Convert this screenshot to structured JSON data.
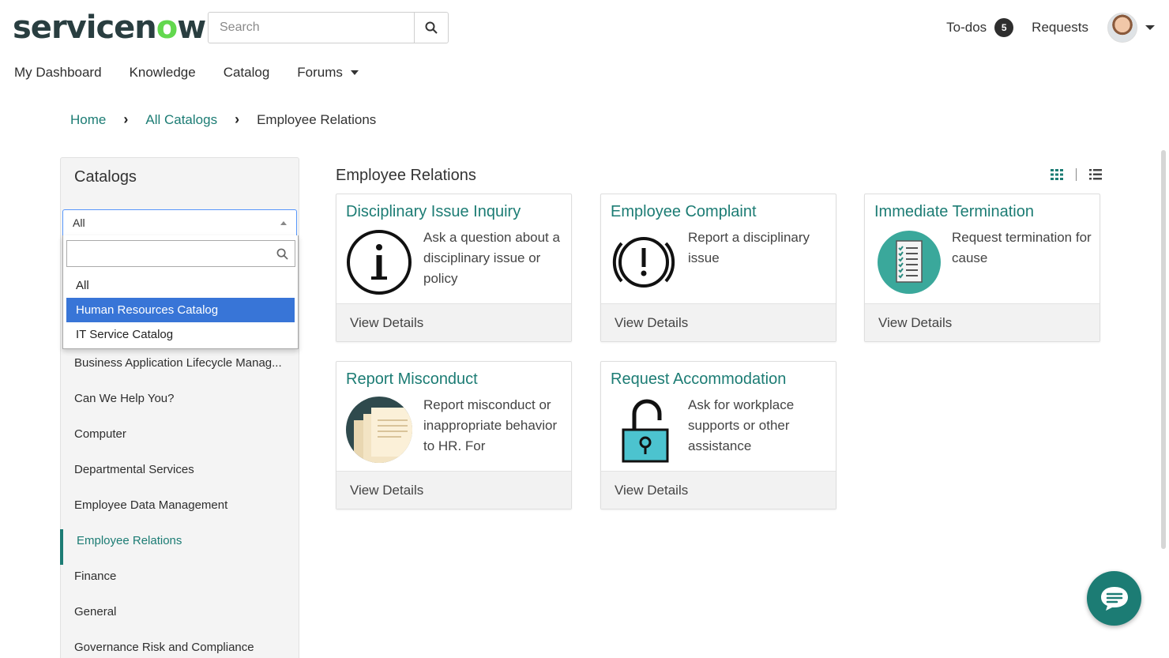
{
  "brand": {
    "logo_text_a": "servicen",
    "logo_text_o": "o",
    "logo_text_b": "w"
  },
  "search": {
    "placeholder": "Search"
  },
  "header": {
    "todos_label": "To-dos",
    "todos_count": "5",
    "requests_label": "Requests"
  },
  "nav": {
    "items": [
      "My Dashboard",
      "Knowledge",
      "Catalog",
      "Forums"
    ]
  },
  "breadcrumb": {
    "home": "Home",
    "all_catalogs": "All Catalogs",
    "current": "Employee Relations"
  },
  "sidebar": {
    "title": "Catalogs",
    "select_value": "All",
    "dropdown_options": [
      "All",
      "Human Resources Catalog",
      "IT Service Catalog"
    ],
    "categories": [
      "Business Application Lifecycle Manag...",
      "Can We Help You?",
      "Computer",
      "Departmental Services",
      "Employee Data Management",
      "Employee Relations",
      "Finance",
      "General",
      "Governance Risk and Compliance"
    ]
  },
  "main": {
    "title": "Employee Relations",
    "cards": [
      {
        "title": "Disciplinary Issue Inquiry",
        "desc": "Ask a question about a disciplinary issue or policy",
        "footer": "View Details",
        "icon": "info-icon"
      },
      {
        "title": "Employee Complaint",
        "desc": "Report a disciplinary issue",
        "footer": "View Details",
        "icon": "alert-icon"
      },
      {
        "title": "Immediate Termination",
        "desc": "Request termination for cause",
        "footer": "View Details",
        "icon": "checklist-icon"
      },
      {
        "title": "Report Misconduct",
        "desc": "Report misconduct or inappropriate behavior to HR. For",
        "footer": "View Details",
        "icon": "documents-icon"
      },
      {
        "title": "Request Accommodation",
        "desc": "Ask for workplace supports or other assistance",
        "footer": "View Details",
        "icon": "unlock-icon"
      }
    ]
  },
  "colors": {
    "accent": "#1c7c74",
    "selected": "#3875d7",
    "brand_dark": "#293e40",
    "brand_green": "#62d84e"
  }
}
